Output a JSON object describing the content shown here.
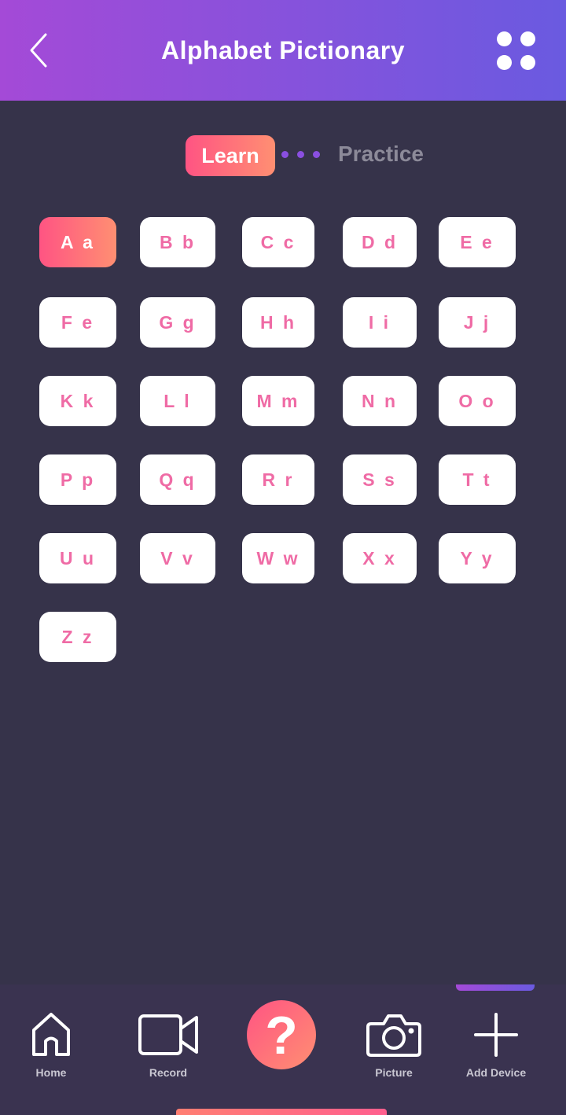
{
  "header": {
    "title": "Alphabet Pictionary",
    "back_icon": "chevron-left-icon",
    "menu_icon": "grid-dots-icon"
  },
  "tabs": {
    "learn": "Learn",
    "practice": "Practice",
    "active": "learn"
  },
  "letters": [
    "A a",
    "B b",
    "C c",
    "D d",
    "E e",
    "F e",
    "G g",
    "H h",
    "I i",
    "J j",
    "K k",
    "L l",
    "M m",
    "N n",
    "O o",
    "P p",
    "Q q",
    "R r",
    "S s",
    "T t",
    "U u",
    "V v",
    "W w",
    "X x",
    "Y y",
    "Z z"
  ],
  "selected_letter": "A a",
  "nav": {
    "home": "Home",
    "record": "Record",
    "help": "?",
    "picture": "Picture",
    "add_device": "Add Device"
  },
  "colors": {
    "background": "#36334a",
    "header_gradient_start": "#a44ad7",
    "header_gradient_end": "#6a5ae0",
    "accent_gradient_start": "#ff5483",
    "accent_gradient_end": "#ff8f72",
    "letter_text": "#ef6ba5"
  }
}
